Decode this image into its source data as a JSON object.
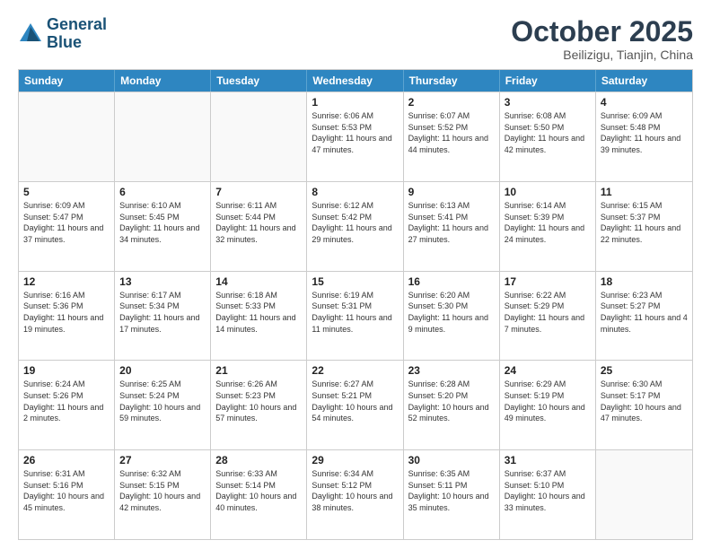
{
  "logo": {
    "line1": "General",
    "line2": "Blue"
  },
  "title": "October 2025",
  "location": "Beilizigu, Tianjin, China",
  "days_of_week": [
    "Sunday",
    "Monday",
    "Tuesday",
    "Wednesday",
    "Thursday",
    "Friday",
    "Saturday"
  ],
  "weeks": [
    [
      {
        "day": "",
        "empty": true
      },
      {
        "day": "",
        "empty": true
      },
      {
        "day": "",
        "empty": true
      },
      {
        "day": "1",
        "sunrise": "6:06 AM",
        "sunset": "5:53 PM",
        "daylight": "11 hours and 47 minutes."
      },
      {
        "day": "2",
        "sunrise": "6:07 AM",
        "sunset": "5:52 PM",
        "daylight": "11 hours and 44 minutes."
      },
      {
        "day": "3",
        "sunrise": "6:08 AM",
        "sunset": "5:50 PM",
        "daylight": "11 hours and 42 minutes."
      },
      {
        "day": "4",
        "sunrise": "6:09 AM",
        "sunset": "5:48 PM",
        "daylight": "11 hours and 39 minutes."
      }
    ],
    [
      {
        "day": "5",
        "sunrise": "6:09 AM",
        "sunset": "5:47 PM",
        "daylight": "11 hours and 37 minutes."
      },
      {
        "day": "6",
        "sunrise": "6:10 AM",
        "sunset": "5:45 PM",
        "daylight": "11 hours and 34 minutes."
      },
      {
        "day": "7",
        "sunrise": "6:11 AM",
        "sunset": "5:44 PM",
        "daylight": "11 hours and 32 minutes."
      },
      {
        "day": "8",
        "sunrise": "6:12 AM",
        "sunset": "5:42 PM",
        "daylight": "11 hours and 29 minutes."
      },
      {
        "day": "9",
        "sunrise": "6:13 AM",
        "sunset": "5:41 PM",
        "daylight": "11 hours and 27 minutes."
      },
      {
        "day": "10",
        "sunrise": "6:14 AM",
        "sunset": "5:39 PM",
        "daylight": "11 hours and 24 minutes."
      },
      {
        "day": "11",
        "sunrise": "6:15 AM",
        "sunset": "5:37 PM",
        "daylight": "11 hours and 22 minutes."
      }
    ],
    [
      {
        "day": "12",
        "sunrise": "6:16 AM",
        "sunset": "5:36 PM",
        "daylight": "11 hours and 19 minutes."
      },
      {
        "day": "13",
        "sunrise": "6:17 AM",
        "sunset": "5:34 PM",
        "daylight": "11 hours and 17 minutes."
      },
      {
        "day": "14",
        "sunrise": "6:18 AM",
        "sunset": "5:33 PM",
        "daylight": "11 hours and 14 minutes."
      },
      {
        "day": "15",
        "sunrise": "6:19 AM",
        "sunset": "5:31 PM",
        "daylight": "11 hours and 11 minutes."
      },
      {
        "day": "16",
        "sunrise": "6:20 AM",
        "sunset": "5:30 PM",
        "daylight": "11 hours and 9 minutes."
      },
      {
        "day": "17",
        "sunrise": "6:22 AM",
        "sunset": "5:29 PM",
        "daylight": "11 hours and 7 minutes."
      },
      {
        "day": "18",
        "sunrise": "6:23 AM",
        "sunset": "5:27 PM",
        "daylight": "11 hours and 4 minutes."
      }
    ],
    [
      {
        "day": "19",
        "sunrise": "6:24 AM",
        "sunset": "5:26 PM",
        "daylight": "11 hours and 2 minutes."
      },
      {
        "day": "20",
        "sunrise": "6:25 AM",
        "sunset": "5:24 PM",
        "daylight": "10 hours and 59 minutes."
      },
      {
        "day": "21",
        "sunrise": "6:26 AM",
        "sunset": "5:23 PM",
        "daylight": "10 hours and 57 minutes."
      },
      {
        "day": "22",
        "sunrise": "6:27 AM",
        "sunset": "5:21 PM",
        "daylight": "10 hours and 54 minutes."
      },
      {
        "day": "23",
        "sunrise": "6:28 AM",
        "sunset": "5:20 PM",
        "daylight": "10 hours and 52 minutes."
      },
      {
        "day": "24",
        "sunrise": "6:29 AM",
        "sunset": "5:19 PM",
        "daylight": "10 hours and 49 minutes."
      },
      {
        "day": "25",
        "sunrise": "6:30 AM",
        "sunset": "5:17 PM",
        "daylight": "10 hours and 47 minutes."
      }
    ],
    [
      {
        "day": "26",
        "sunrise": "6:31 AM",
        "sunset": "5:16 PM",
        "daylight": "10 hours and 45 minutes."
      },
      {
        "day": "27",
        "sunrise": "6:32 AM",
        "sunset": "5:15 PM",
        "daylight": "10 hours and 42 minutes."
      },
      {
        "day": "28",
        "sunrise": "6:33 AM",
        "sunset": "5:14 PM",
        "daylight": "10 hours and 40 minutes."
      },
      {
        "day": "29",
        "sunrise": "6:34 AM",
        "sunset": "5:12 PM",
        "daylight": "10 hours and 38 minutes."
      },
      {
        "day": "30",
        "sunrise": "6:35 AM",
        "sunset": "5:11 PM",
        "daylight": "10 hours and 35 minutes."
      },
      {
        "day": "31",
        "sunrise": "6:37 AM",
        "sunset": "5:10 PM",
        "daylight": "10 hours and 33 minutes."
      },
      {
        "day": "",
        "empty": true
      }
    ]
  ]
}
